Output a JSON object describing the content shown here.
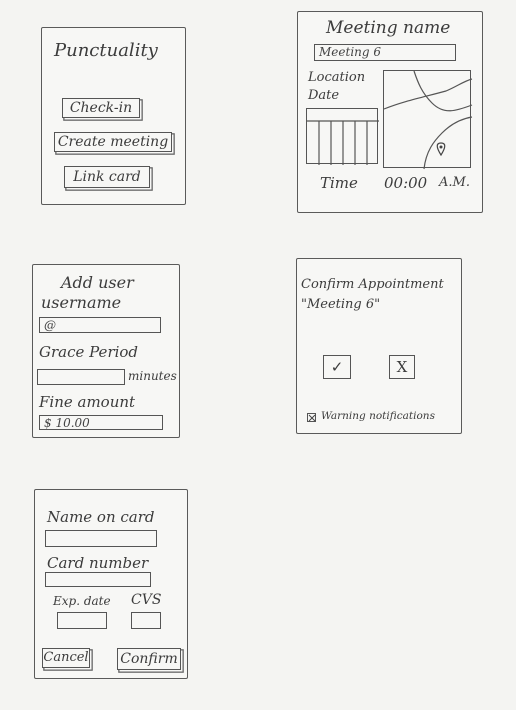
{
  "screen_punctuality": {
    "title": "Punctuality",
    "buttons": [
      "Check-in",
      "Create meeting",
      "Link card"
    ]
  },
  "screen_meeting": {
    "title": "Meeting name",
    "name_value": "Meeting 6",
    "location_label": "Location",
    "date_label": "Date",
    "time_label": "Time",
    "time_value": "00:00",
    "ampm": "A.M."
  },
  "screen_add_user": {
    "title": "Add user",
    "username_label": "username",
    "username_value": "@",
    "grace_label": "Grace Period",
    "minutes_label": "minutes",
    "fine_label": "Fine amount",
    "fine_value": "$ 10.00"
  },
  "screen_confirm": {
    "title": "Confirm Appointment",
    "meeting_value": "\"Meeting 6\"",
    "accept_symbol": "✓",
    "reject_symbol": "X",
    "warning_label": "Warning notifications",
    "warning_checked": true
  },
  "screen_card": {
    "name_label": "Name on card",
    "number_label": "Card number",
    "exp_label": "Exp. date",
    "cvs_label": "CVS",
    "cancel_label": "Cancel",
    "confirm_label": "Confirm"
  }
}
